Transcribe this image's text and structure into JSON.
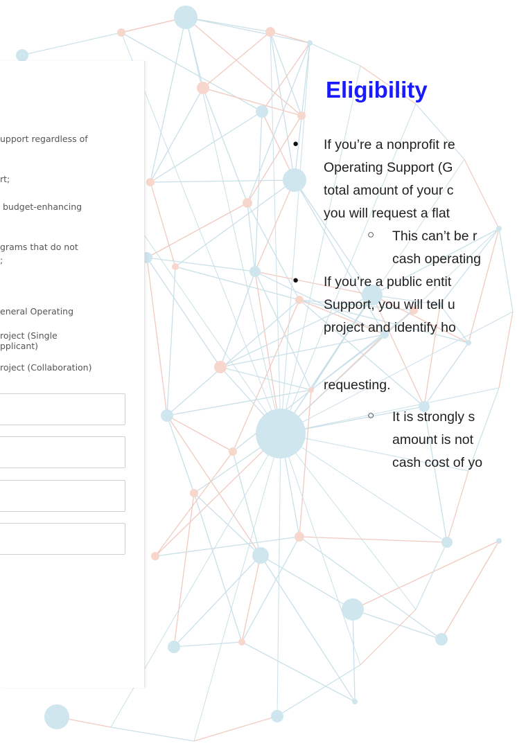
{
  "form": {
    "lines": [
      "upport regardless of",
      "rt;",
      " budget-enhancing",
      "grams that do not",
      ";",
      "eneral Operating",
      "roject (Single",
      "pplicant)",
      "roject (Collaboration)"
    ]
  },
  "slide": {
    "title": "Eligibility",
    "bullets": [
      {
        "lines": [
          "If you’re a nonprofit re",
          "Operating Support (G",
          "total amount of your c",
          "you will request a flat"
        ],
        "sub": {
          "lines": [
            "This can’t be r",
            "cash operating"
          ]
        }
      },
      {
        "lines": [
          "If you’re a public entit",
          "Support, you will tell u",
          "project and identify ho",
          "requesting."
        ],
        "sub": {
          "lines": [
            "It is strongly s",
            "amount is not",
            "cash cost of yo"
          ]
        }
      }
    ],
    "bullet_glyph": "●",
    "sub_bullet_glyph": "○"
  },
  "colors": {
    "title": "#1a1aff",
    "node_blue": "#cfe6ee",
    "node_pink": "#f7d6cc",
    "line_blue": "#c9e0e8",
    "line_pink": "#f1c9bf"
  }
}
